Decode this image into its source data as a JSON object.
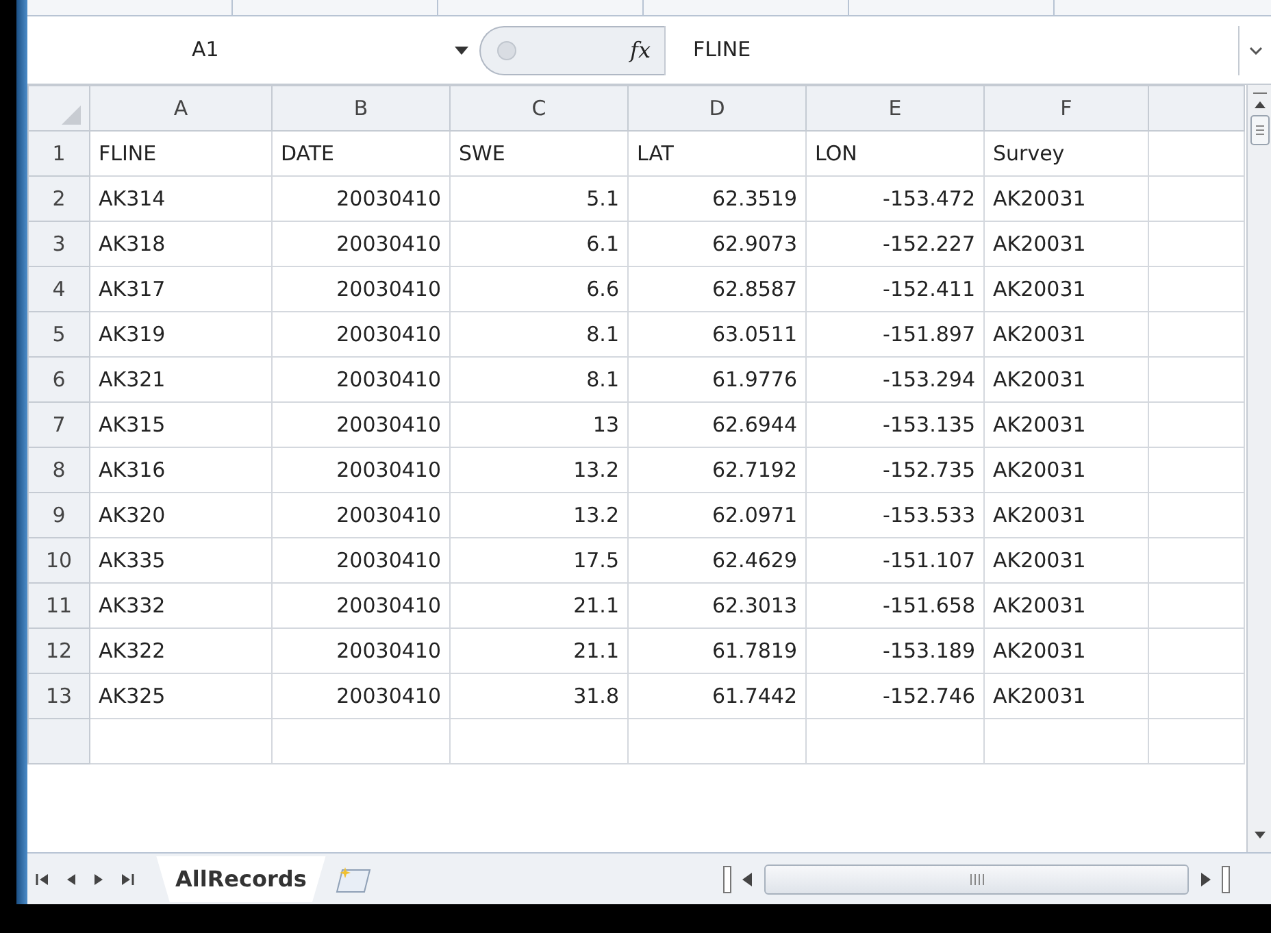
{
  "formula_bar": {
    "name_box": "A1",
    "fx": "fx",
    "value": "FLINE"
  },
  "columns": [
    {
      "letter": "A",
      "kind": "text"
    },
    {
      "letter": "B",
      "kind": "number"
    },
    {
      "letter": "C",
      "kind": "number"
    },
    {
      "letter": "D",
      "kind": "number"
    },
    {
      "letter": "E",
      "kind": "number"
    },
    {
      "letter": "F",
      "kind": "text"
    }
  ],
  "rows": [
    {
      "number": "1",
      "kind": "header",
      "cells": [
        "FLINE",
        "DATE",
        "SWE",
        "LAT",
        "LON",
        "Survey"
      ]
    },
    {
      "number": "2",
      "kind": "data",
      "cells": [
        "AK314",
        "20030410",
        "5.1",
        "62.3519",
        "-153.472",
        "AK20031"
      ]
    },
    {
      "number": "3",
      "kind": "data",
      "cells": [
        "AK318",
        "20030410",
        "6.1",
        "62.9073",
        "-152.227",
        "AK20031"
      ]
    },
    {
      "number": "4",
      "kind": "data",
      "cells": [
        "AK317",
        "20030410",
        "6.6",
        "62.8587",
        "-152.411",
        "AK20031"
      ]
    },
    {
      "number": "5",
      "kind": "data",
      "cells": [
        "AK319",
        "20030410",
        "8.1",
        "63.0511",
        "-151.897",
        "AK20031"
      ]
    },
    {
      "number": "6",
      "kind": "data",
      "cells": [
        "AK321",
        "20030410",
        "8.1",
        "61.9776",
        "-153.294",
        "AK20031"
      ]
    },
    {
      "number": "7",
      "kind": "data",
      "cells": [
        "AK315",
        "20030410",
        "13",
        "62.6944",
        "-153.135",
        "AK20031"
      ]
    },
    {
      "number": "8",
      "kind": "data",
      "cells": [
        "AK316",
        "20030410",
        "13.2",
        "62.7192",
        "-152.735",
        "AK20031"
      ]
    },
    {
      "number": "9",
      "kind": "data",
      "cells": [
        "AK320",
        "20030410",
        "13.2",
        "62.0971",
        "-153.533",
        "AK20031"
      ]
    },
    {
      "number": "10",
      "kind": "data",
      "cells": [
        "AK335",
        "20030410",
        "17.5",
        "62.4629",
        "-151.107",
        "AK20031"
      ]
    },
    {
      "number": "11",
      "kind": "data",
      "cells": [
        "AK332",
        "20030410",
        "21.1",
        "62.3013",
        "-151.658",
        "AK20031"
      ]
    },
    {
      "number": "12",
      "kind": "data",
      "cells": [
        "AK322",
        "20030410",
        "21.1",
        "61.7819",
        "-153.189",
        "AK20031"
      ]
    },
    {
      "number": "13",
      "kind": "data",
      "cells": [
        "AK325",
        "20030410",
        "31.8",
        "61.7442",
        "-152.746",
        "AK20031"
      ]
    }
  ],
  "sheet_tabs": [
    {
      "label": "AllRecords",
      "selected": true
    }
  ]
}
